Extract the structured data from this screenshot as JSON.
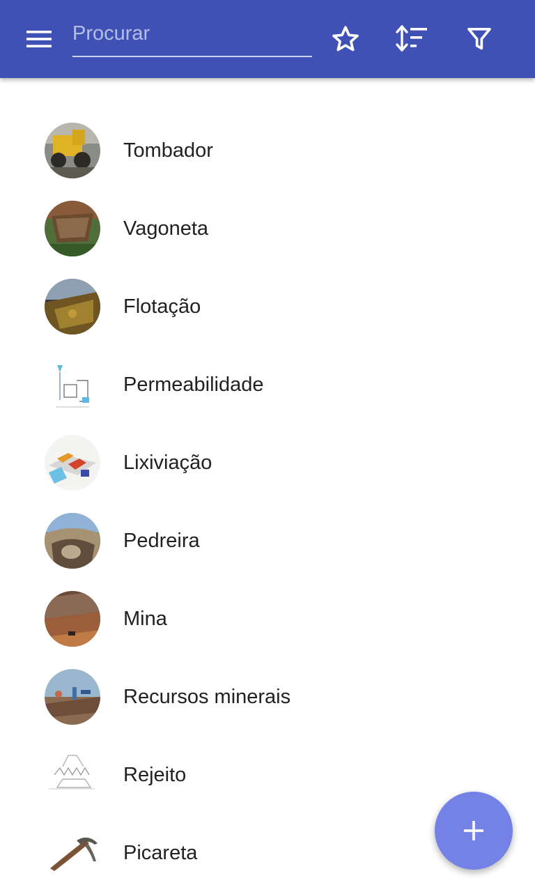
{
  "appbar": {
    "background": "#3f51b5",
    "menu_icon": "hamburger-menu-icon",
    "search": {
      "placeholder": "Procurar",
      "value": ""
    },
    "actions": [
      {
        "icon": "star-outline-icon",
        "label": "favorites"
      },
      {
        "icon": "sort-icon",
        "label": "sort"
      },
      {
        "icon": "filter-icon",
        "label": "filter"
      }
    ]
  },
  "list": {
    "items": [
      {
        "label": "Tombador"
      },
      {
        "label": "Vagoneta"
      },
      {
        "label": "Flotação"
      },
      {
        "label": "Permeabilidade"
      },
      {
        "label": "Lixiviação"
      },
      {
        "label": "Pedreira"
      },
      {
        "label": "Mina"
      },
      {
        "label": "Recursos minerais"
      },
      {
        "label": "Rejeito"
      },
      {
        "label": "Picareta"
      }
    ]
  },
  "fab": {
    "icon": "plus-icon",
    "color": "#7482e6"
  }
}
